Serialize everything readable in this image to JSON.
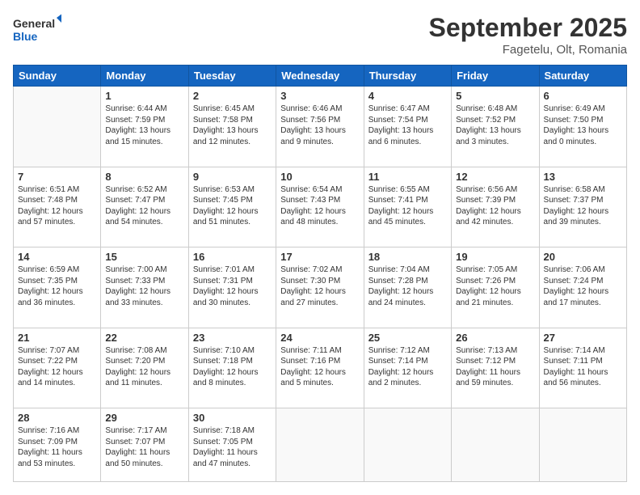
{
  "header": {
    "logo_line1": "General",
    "logo_line2": "Blue",
    "month": "September 2025",
    "location": "Fagetelu, Olt, Romania"
  },
  "weekdays": [
    "Sunday",
    "Monday",
    "Tuesday",
    "Wednesday",
    "Thursday",
    "Friday",
    "Saturday"
  ],
  "weeks": [
    [
      {
        "day": "",
        "text": ""
      },
      {
        "day": "1",
        "text": "Sunrise: 6:44 AM\nSunset: 7:59 PM\nDaylight: 13 hours\nand 15 minutes."
      },
      {
        "day": "2",
        "text": "Sunrise: 6:45 AM\nSunset: 7:58 PM\nDaylight: 13 hours\nand 12 minutes."
      },
      {
        "day": "3",
        "text": "Sunrise: 6:46 AM\nSunset: 7:56 PM\nDaylight: 13 hours\nand 9 minutes."
      },
      {
        "day": "4",
        "text": "Sunrise: 6:47 AM\nSunset: 7:54 PM\nDaylight: 13 hours\nand 6 minutes."
      },
      {
        "day": "5",
        "text": "Sunrise: 6:48 AM\nSunset: 7:52 PM\nDaylight: 13 hours\nand 3 minutes."
      },
      {
        "day": "6",
        "text": "Sunrise: 6:49 AM\nSunset: 7:50 PM\nDaylight: 13 hours\nand 0 minutes."
      }
    ],
    [
      {
        "day": "7",
        "text": "Sunrise: 6:51 AM\nSunset: 7:48 PM\nDaylight: 12 hours\nand 57 minutes."
      },
      {
        "day": "8",
        "text": "Sunrise: 6:52 AM\nSunset: 7:47 PM\nDaylight: 12 hours\nand 54 minutes."
      },
      {
        "day": "9",
        "text": "Sunrise: 6:53 AM\nSunset: 7:45 PM\nDaylight: 12 hours\nand 51 minutes."
      },
      {
        "day": "10",
        "text": "Sunrise: 6:54 AM\nSunset: 7:43 PM\nDaylight: 12 hours\nand 48 minutes."
      },
      {
        "day": "11",
        "text": "Sunrise: 6:55 AM\nSunset: 7:41 PM\nDaylight: 12 hours\nand 45 minutes."
      },
      {
        "day": "12",
        "text": "Sunrise: 6:56 AM\nSunset: 7:39 PM\nDaylight: 12 hours\nand 42 minutes."
      },
      {
        "day": "13",
        "text": "Sunrise: 6:58 AM\nSunset: 7:37 PM\nDaylight: 12 hours\nand 39 minutes."
      }
    ],
    [
      {
        "day": "14",
        "text": "Sunrise: 6:59 AM\nSunset: 7:35 PM\nDaylight: 12 hours\nand 36 minutes."
      },
      {
        "day": "15",
        "text": "Sunrise: 7:00 AM\nSunset: 7:33 PM\nDaylight: 12 hours\nand 33 minutes."
      },
      {
        "day": "16",
        "text": "Sunrise: 7:01 AM\nSunset: 7:31 PM\nDaylight: 12 hours\nand 30 minutes."
      },
      {
        "day": "17",
        "text": "Sunrise: 7:02 AM\nSunset: 7:30 PM\nDaylight: 12 hours\nand 27 minutes."
      },
      {
        "day": "18",
        "text": "Sunrise: 7:04 AM\nSunset: 7:28 PM\nDaylight: 12 hours\nand 24 minutes."
      },
      {
        "day": "19",
        "text": "Sunrise: 7:05 AM\nSunset: 7:26 PM\nDaylight: 12 hours\nand 21 minutes."
      },
      {
        "day": "20",
        "text": "Sunrise: 7:06 AM\nSunset: 7:24 PM\nDaylight: 12 hours\nand 17 minutes."
      }
    ],
    [
      {
        "day": "21",
        "text": "Sunrise: 7:07 AM\nSunset: 7:22 PM\nDaylight: 12 hours\nand 14 minutes."
      },
      {
        "day": "22",
        "text": "Sunrise: 7:08 AM\nSunset: 7:20 PM\nDaylight: 12 hours\nand 11 minutes."
      },
      {
        "day": "23",
        "text": "Sunrise: 7:10 AM\nSunset: 7:18 PM\nDaylight: 12 hours\nand 8 minutes."
      },
      {
        "day": "24",
        "text": "Sunrise: 7:11 AM\nSunset: 7:16 PM\nDaylight: 12 hours\nand 5 minutes."
      },
      {
        "day": "25",
        "text": "Sunrise: 7:12 AM\nSunset: 7:14 PM\nDaylight: 12 hours\nand 2 minutes."
      },
      {
        "day": "26",
        "text": "Sunrise: 7:13 AM\nSunset: 7:12 PM\nDaylight: 11 hours\nand 59 minutes."
      },
      {
        "day": "27",
        "text": "Sunrise: 7:14 AM\nSunset: 7:11 PM\nDaylight: 11 hours\nand 56 minutes."
      }
    ],
    [
      {
        "day": "28",
        "text": "Sunrise: 7:16 AM\nSunset: 7:09 PM\nDaylight: 11 hours\nand 53 minutes."
      },
      {
        "day": "29",
        "text": "Sunrise: 7:17 AM\nSunset: 7:07 PM\nDaylight: 11 hours\nand 50 minutes."
      },
      {
        "day": "30",
        "text": "Sunrise: 7:18 AM\nSunset: 7:05 PM\nDaylight: 11 hours\nand 47 minutes."
      },
      {
        "day": "",
        "text": ""
      },
      {
        "day": "",
        "text": ""
      },
      {
        "day": "",
        "text": ""
      },
      {
        "day": "",
        "text": ""
      }
    ]
  ]
}
